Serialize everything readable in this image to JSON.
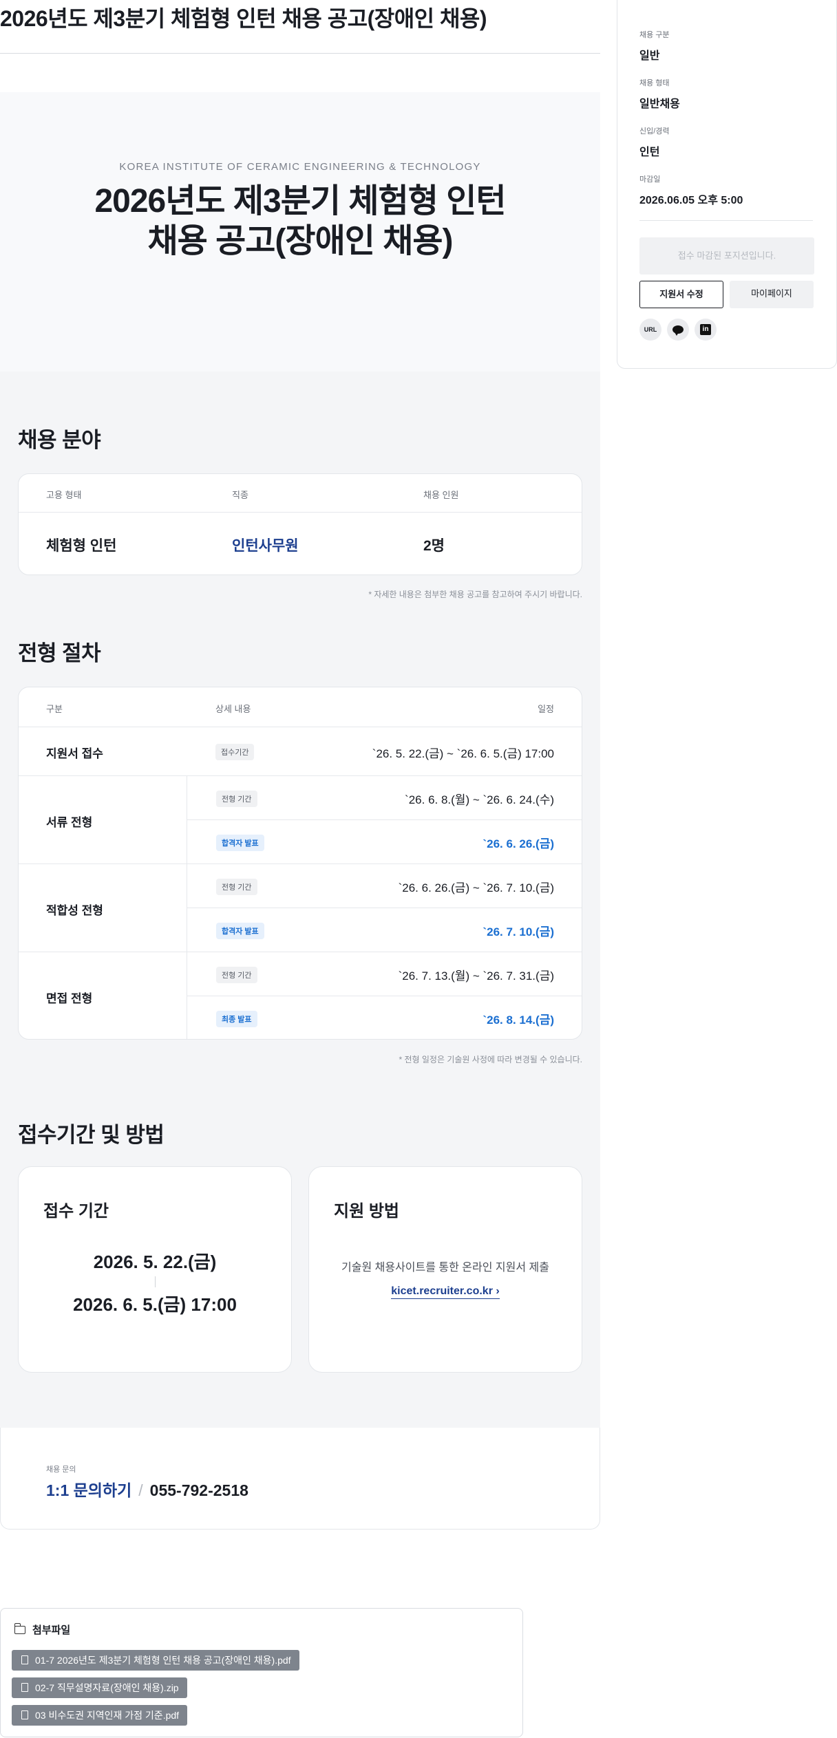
{
  "page_title": "2026년도 제3분기 체험형 인턴 채용 공고(장애인 채용)",
  "hero": {
    "subtitle": "KOREA INSTITUTE OF CERAMIC ENGINEERING & TECHNOLOGY",
    "title_line1": "2026년도 제3분기 체험형 인턴",
    "title_line2": "채용 공고(장애인 채용)"
  },
  "field_section": {
    "title": "채용 분야",
    "headers": [
      "고용 형태",
      "직종",
      "채용 인원"
    ],
    "row": [
      "체험형 인턴",
      "인턴사무원",
      "2명"
    ],
    "note": "* 자세한 내용은 첨부한 채용 공고를 참고하여 주시기 바랍니다."
  },
  "process_section": {
    "title": "전형 절차",
    "headers": [
      "구분",
      "상세 내용",
      "일정"
    ],
    "steps": [
      {
        "name": "지원서 접수",
        "subs": [
          {
            "badge": "접수기간",
            "date": "`26. 5. 22.(금) ~ `26. 6. 5.(금) 17:00",
            "highlight": false
          }
        ]
      },
      {
        "name": "서류 전형",
        "subs": [
          {
            "badge": "전형 기간",
            "date": "`26. 6. 8.(월) ~ `26. 6. 24.(수)",
            "highlight": false
          },
          {
            "badge": "합격자 발표",
            "date": "`26. 6. 26.(금)",
            "highlight": true
          }
        ]
      },
      {
        "name": "적합성 전형",
        "subs": [
          {
            "badge": "전형 기간",
            "date": "`26. 6. 26.(금) ~ `26. 7. 10.(금)",
            "highlight": false
          },
          {
            "badge": "합격자 발표",
            "date": "`26. 7. 10.(금)",
            "highlight": true
          }
        ]
      },
      {
        "name": "면접 전형",
        "subs": [
          {
            "badge": "전형 기간",
            "date": "`26. 7. 13.(월) ~ `26. 7. 31.(금)",
            "highlight": false
          },
          {
            "badge": "최종 발표",
            "date": "`26. 8. 14.(금)",
            "highlight": true
          }
        ]
      }
    ],
    "note": "* 전형 일정은 기술원 사정에 따라 변경될 수 있습니다."
  },
  "apply_section": {
    "title": "접수기간 및 방법",
    "period_title": "접수 기간",
    "period_start": "2026. 5. 22.(금)",
    "period_end": "2026. 6. 5.(금) 17:00",
    "method_title": "지원 방법",
    "method_text": "기술원 채용사이트를 통한 온라인 지원서 제출",
    "method_link": "kicet.recruiter.co.kr ›"
  },
  "inquiry": {
    "label": "채용 문의",
    "link": "1:1 문의하기",
    "separator": "/",
    "phone": "055-792-2518"
  },
  "attachments": {
    "title": "첨부파일",
    "files": [
      "01-7 2026년도 제3분기 체험형 인턴 채용 공고(장애인 채용).pdf",
      "02-7 직무설명자료(장애인 채용).zip",
      "03 비수도권 지역인재 가점 기준.pdf"
    ]
  },
  "sidebar": {
    "items": [
      {
        "label": "채용 구분",
        "value": "일반"
      },
      {
        "label": "채용 형태",
        "value": "일반채용"
      },
      {
        "label": "신입/경력",
        "value": "인턴"
      },
      {
        "label": "마감일",
        "value": "2026.06.05 오후 5:00"
      }
    ],
    "closed_text": "접수 마감된 포지션입니다.",
    "edit_button": "지원서 수정",
    "mypage_button": "마이페이지",
    "share_url": "URL",
    "share_in": "in"
  },
  "colors": {
    "accent_blue": "#1d3f8f",
    "highlight_blue": "#1b6fd1",
    "gray_bg": "#f4f5f7"
  }
}
